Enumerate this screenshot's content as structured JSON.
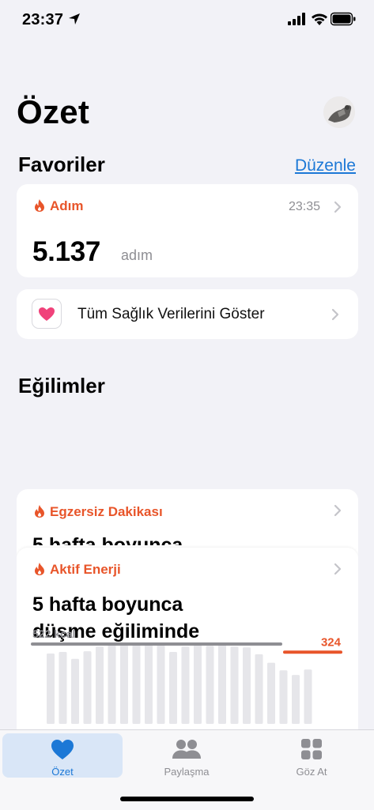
{
  "status_bar": {
    "time": "23:37",
    "icons": [
      "location-arrow-icon",
      "cellular-signal-icon",
      "wifi-icon",
      "battery-icon"
    ]
  },
  "header": {
    "title": "Özet",
    "avatar_icon": "profile-avatar"
  },
  "favorites": {
    "section_title": "Favoriler",
    "edit_label": "Düzenle",
    "steps_card": {
      "label": "Adım",
      "time": "23:35",
      "value": "5.137",
      "unit": "adım",
      "icon": "flame-icon"
    },
    "all_health_card": {
      "label": "Tüm Sağlık Verilerini Göster",
      "icon": "health-heart-icon"
    }
  },
  "trends": {
    "section_title": "Eğilimler",
    "exercise_card": {
      "label": "Egzersiz Dakikası",
      "peek_text": "5 hafta boyunca"
    },
    "energy_card": {
      "label": "Aktif Enerji",
      "summary_line1": "5 hafta boyunca",
      "summary_line2": "düşme eğiliminde",
      "avg_label": "522 kcal",
      "current_label": "324"
    }
  },
  "chart_data": {
    "type": "bar",
    "title": "Aktif Enerji",
    "series": [
      {
        "name": "Aktif Enerji",
        "values": [
          460,
          470,
          425,
          475,
          505,
          520,
          515,
          525,
          530,
          520,
          470,
          505,
          525,
          510,
          520,
          505,
          500,
          455,
          400,
          350,
          320,
          355
        ]
      }
    ],
    "reference_lines": [
      {
        "label": "522 kcal",
        "value": 522,
        "color": "#8e8e93"
      },
      {
        "label": "324",
        "value": 324,
        "color": "#e8552a"
      }
    ],
    "ylim": [
      0,
      620
    ]
  },
  "tabbar": {
    "tabs": [
      {
        "label": "Özet",
        "icon": "heart-icon",
        "active": true
      },
      {
        "label": "Paylaşma",
        "icon": "people-icon",
        "active": false
      },
      {
        "label": "Göz At",
        "icon": "grid-icon",
        "active": false
      }
    ]
  },
  "colors": {
    "accent": "#1c78d6",
    "activity": "#e8552a",
    "background": "#f2f2f7",
    "secondary_text": "#8e8e93"
  }
}
